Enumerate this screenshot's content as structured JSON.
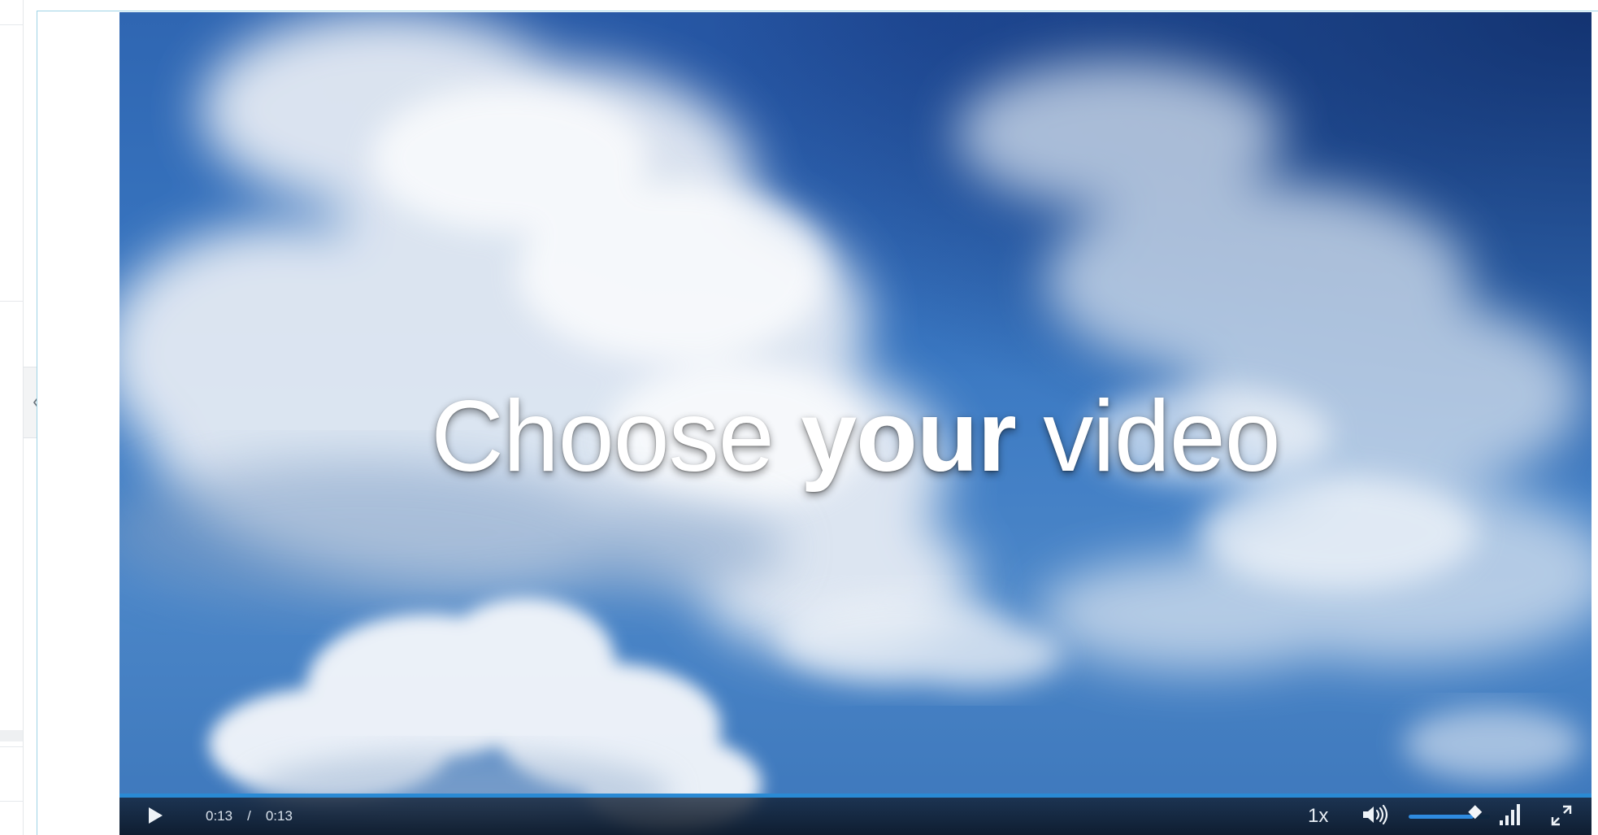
{
  "player": {
    "title_part1": "Choose ",
    "title_part2": "your",
    "title_part3": " video",
    "current_time": "0:13",
    "time_separator": "/",
    "duration": "0:13",
    "playback_speed": "1x",
    "progress_percent": 100,
    "volume_percent": 80,
    "accent_color": "#2a8ad4"
  },
  "icons": {
    "play": "play-icon",
    "volume": "volume-icon",
    "quality": "signal-bars-icon",
    "fullscreen": "fullscreen-icon",
    "collapse": "chevron-left-icon"
  }
}
